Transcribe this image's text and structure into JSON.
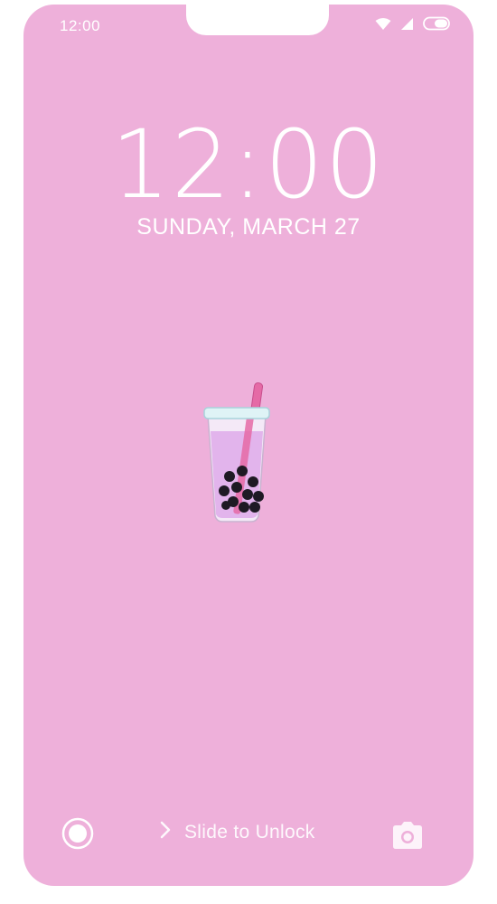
{
  "status_bar": {
    "time": "12:00",
    "icons": [
      "wifi-icon",
      "signal-icon",
      "battery-icon"
    ]
  },
  "lock_screen": {
    "clock": "12:00",
    "date": "SUNDAY, MARCH 27"
  },
  "wallpaper": {
    "background_color": "#eeb0da",
    "illustration": "boba-tea-cup-icon"
  },
  "bottom_bar": {
    "left_icon": "record-icon",
    "slide_label": "Slide to Unlock",
    "right_icon": "camera-icon"
  }
}
